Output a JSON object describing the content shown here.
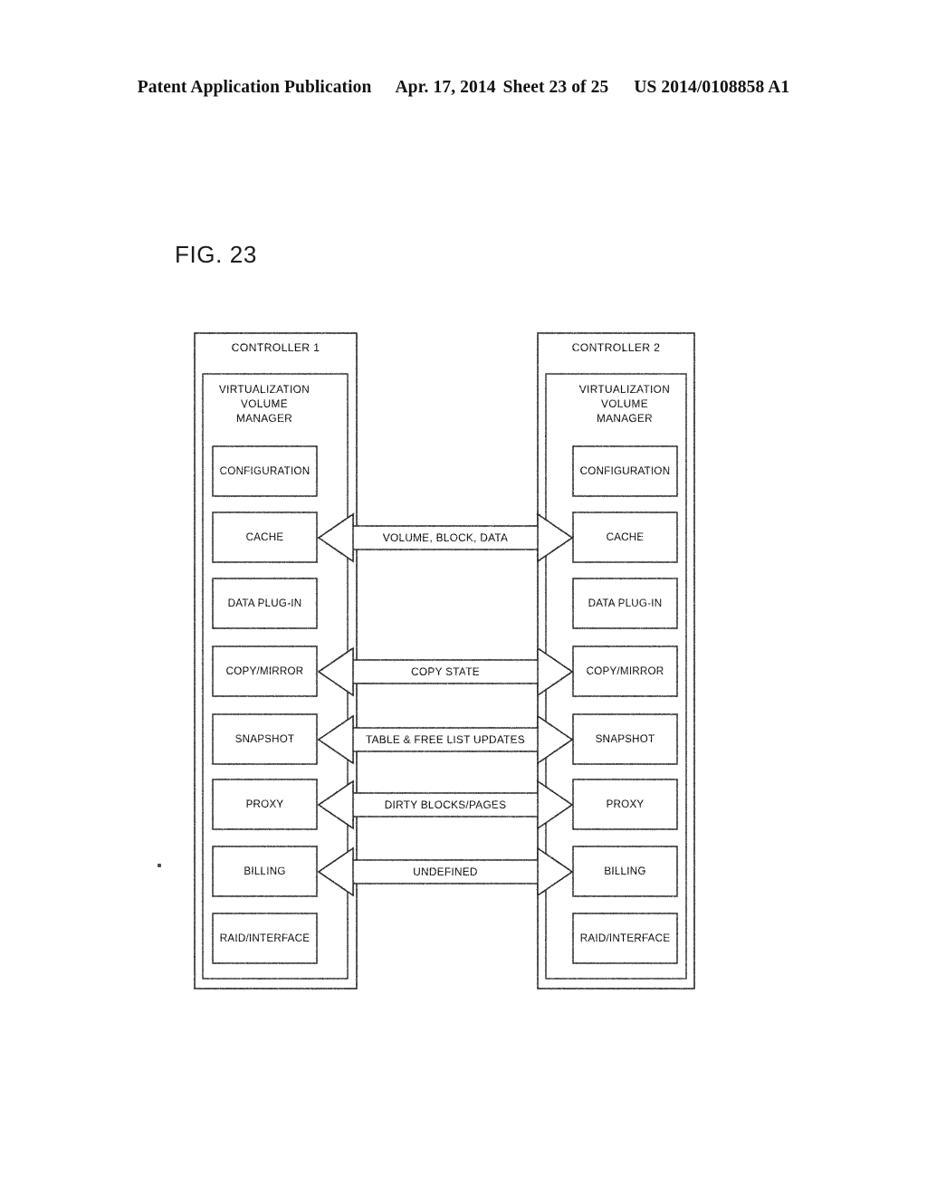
{
  "header": {
    "publication": "Patent Application Publication",
    "date": "Apr. 17, 2014",
    "sheet": "Sheet 23 of 25",
    "patent_number": "US 2014/0108858 A1"
  },
  "figure": {
    "label": "FIG. 23"
  },
  "diagram": {
    "controllers": [
      {
        "title": "CONTROLLER 1",
        "manager_title_lines": [
          "VIRTUALIZATION",
          "VOLUME",
          "MANAGER"
        ],
        "modules": [
          "CONFIGURATION",
          "CACHE",
          "DATA PLUG-IN",
          "COPY/MIRROR",
          "SNAPSHOT",
          "PROXY",
          "BILLING",
          "RAID/INTERFACE"
        ]
      },
      {
        "title": "CONTROLLER 2",
        "manager_title_lines": [
          "VIRTUALIZATION",
          "VOLUME",
          "MANAGER"
        ],
        "modules": [
          "CONFIGURATION",
          "CACHE",
          "DATA PLUG-IN",
          "COPY/MIRROR",
          "SNAPSHOT",
          "PROXY",
          "BILLING",
          "RAID/INTERFACE"
        ]
      }
    ],
    "connections": [
      {
        "label": "VOLUME, BLOCK, DATA",
        "from": "CACHE",
        "to": "CACHE"
      },
      {
        "label": "COPY STATE",
        "from": "COPY/MIRROR",
        "to": "COPY/MIRROR"
      },
      {
        "label": "TABLE & FREE LIST UPDATES",
        "from": "SNAPSHOT",
        "to": "SNAPSHOT"
      },
      {
        "label": "DIRTY BLOCKS/PAGES",
        "from": "PROXY",
        "to": "PROXY"
      },
      {
        "label": "UNDEFINED",
        "from": "BILLING",
        "to": "BILLING"
      }
    ]
  },
  "colors": {
    "ink": "#0d0d0d",
    "line": "#2b2b2b",
    "page": "#ffffff"
  }
}
